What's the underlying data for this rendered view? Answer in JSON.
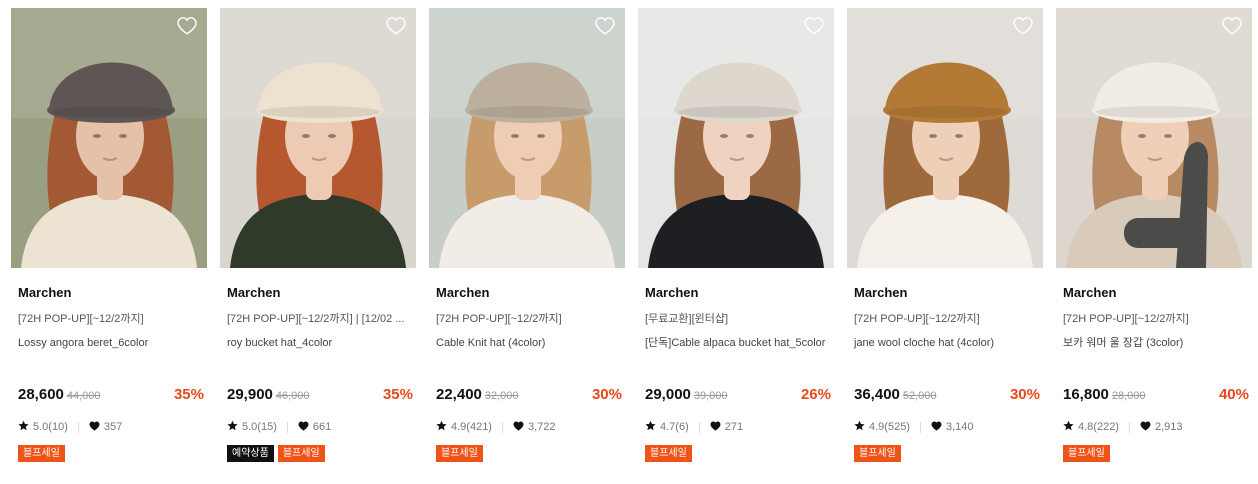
{
  "products": [
    {
      "brand": "Marchen",
      "label": "[72H POP-UP][~12/2까지]",
      "name": "Lossy angora beret_6color",
      "price": "28,600",
      "original_price": "44,000",
      "discount": "35%",
      "rating": "5.0(10)",
      "likes": "357",
      "badges": [
        {
          "text": "블프세일",
          "style": "orange"
        }
      ],
      "photo": {
        "bg": "#9a9f82",
        "hat": "#5e5654",
        "hair": "#a35a34",
        "skin": "#e6c1aa",
        "top": "#ece3d3"
      }
    },
    {
      "brand": "Marchen",
      "label": "[72H POP-UP][~12/2까지] | [12/02 ...",
      "name": "roy bucket hat_4color",
      "price": "29,900",
      "original_price": "46,000",
      "discount": "35%",
      "rating": "5.0(15)",
      "likes": "661",
      "badges": [
        {
          "text": "예약상품",
          "style": "black"
        },
        {
          "text": "블프세일",
          "style": "orange"
        }
      ],
      "photo": {
        "bg": "#d9d5cf",
        "hat": "#ece2cf",
        "hair": "#b5582f",
        "skin": "#edcab4",
        "top": "#2f3a2a"
      }
    },
    {
      "brand": "Marchen",
      "label": "[72H POP-UP][~12/2까지]",
      "name": "Cable Knit hat (4color)",
      "price": "22,400",
      "original_price": "32,000",
      "discount": "30%",
      "rating": "4.9(421)",
      "likes": "3,722",
      "badges": [
        {
          "text": "블프세일",
          "style": "orange"
        }
      ],
      "photo": {
        "bg": "#c7cdc7",
        "hat": "#bcaf9d",
        "hair": "#c89b6b",
        "skin": "#efcdb5",
        "top": "#f1ede6"
      }
    },
    {
      "brand": "Marchen",
      "label": "[무료교환][윈터샵]",
      "name": "[단독]Cable alpaca bucket hat_5color",
      "price": "29,000",
      "original_price": "39,000",
      "discount": "26%",
      "rating": "4.7(6)",
      "likes": "271",
      "badges": [
        {
          "text": "블프세일",
          "style": "orange"
        }
      ],
      "photo": {
        "bg": "#e5e5e3",
        "hat": "#ddd7ce",
        "hair": "#9b6a45",
        "skin": "#efd3c0",
        "top": "#1d1f22"
      }
    },
    {
      "brand": "Marchen",
      "label": "[72H POP-UP][~12/2까지]",
      "name": "jane wool cloche hat (4color)",
      "price": "36,400",
      "original_price": "52,000",
      "discount": "30%",
      "rating": "4.9(525)",
      "likes": "3,140",
      "badges": [
        {
          "text": "블프세일",
          "style": "orange"
        }
      ],
      "photo": {
        "bg": "#dedbd6",
        "hat": "#b27a35",
        "hair": "#9e6a3c",
        "skin": "#eecfb8",
        "top": "#f5f1ea"
      }
    },
    {
      "brand": "Marchen",
      "label": "[72H POP-UP][~12/2까지]",
      "name": "보카 워머 울 장갑 (3color)",
      "price": "16,800",
      "original_price": "28,000",
      "discount": "40%",
      "rating": "4.8(222)",
      "likes": "2,913",
      "badges": [
        {
          "text": "블프세일",
          "style": "orange"
        }
      ],
      "photo": {
        "bg": "#dcd6ce",
        "hat": "#f1ece4",
        "hair": "#b88a63",
        "skin": "#efcfb8",
        "top": "#d9cbb9",
        "glove": "#4b4b49"
      }
    }
  ]
}
